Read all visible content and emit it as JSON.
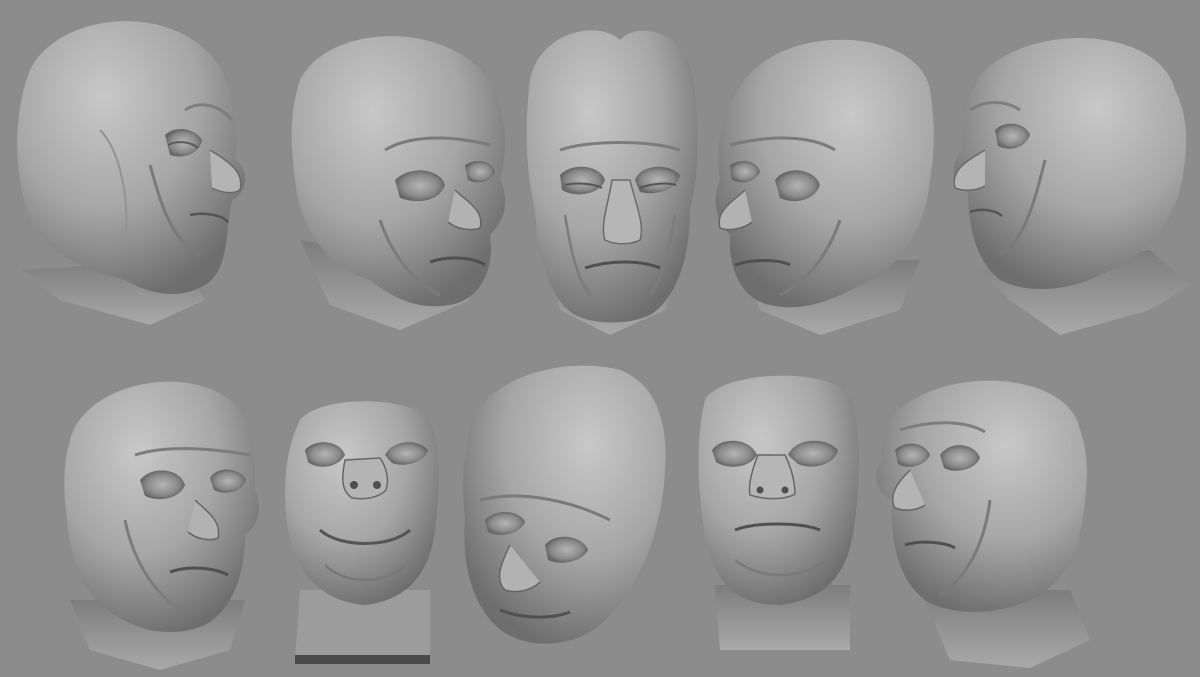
{
  "scene": {
    "background_color": "#8c8c8c",
    "sculpt_base_color": "#a3a3a3",
    "highlight_color": "#c4c4c4",
    "shadow_color": "#5e5e5e",
    "crease_color": "#545454"
  },
  "rows": [
    {
      "name": "top-row",
      "views": [
        {
          "name": "head-view-right-profile",
          "facing": "right",
          "angle": "three-quarter"
        },
        {
          "name": "head-view-right-three-quarter",
          "facing": "right",
          "angle": "three-quarter-low"
        },
        {
          "name": "head-view-front",
          "facing": "front",
          "angle": "front"
        },
        {
          "name": "head-view-left-three-quarter",
          "facing": "left",
          "angle": "three-quarter-low"
        },
        {
          "name": "head-view-left-profile",
          "facing": "left",
          "angle": "three-quarter"
        }
      ]
    },
    {
      "name": "bottom-row",
      "views": [
        {
          "name": "head-view-right-three-quarter-lower",
          "facing": "right",
          "angle": "three-quarter"
        },
        {
          "name": "head-view-from-below-front",
          "facing": "front",
          "angle": "worms-eye"
        },
        {
          "name": "head-view-from-above",
          "facing": "left",
          "angle": "birds-eye"
        },
        {
          "name": "head-view-from-below",
          "facing": "front",
          "angle": "low"
        },
        {
          "name": "head-view-left-three-quarter-lower",
          "facing": "left",
          "angle": "three-quarter"
        }
      ]
    }
  ]
}
